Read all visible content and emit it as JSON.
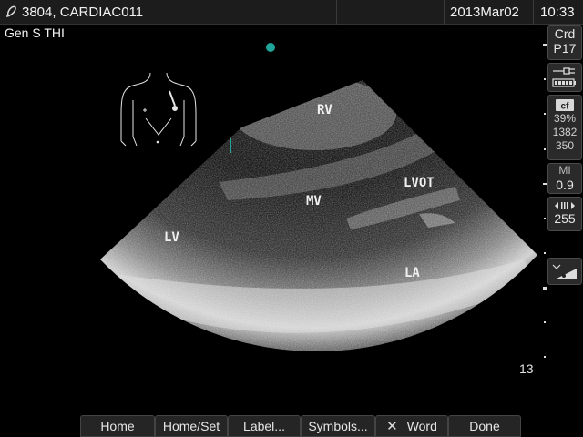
{
  "header": {
    "patient_id": "3804, CARDIAC011",
    "date": "2013Mar02",
    "time": "10:33",
    "logo_icon": "sonosite-logo-icon"
  },
  "imaging": {
    "preset": "Gen S THI",
    "labels": {
      "rv": "RV",
      "lvot": "LVOT",
      "mv": "MV",
      "lv": "LV",
      "la": "LA"
    },
    "depth": "13"
  },
  "right_panel": {
    "exam": "Crd",
    "transducer": "P17",
    "power_icon": "plug-icon",
    "battery_icon": "battery-icon",
    "cf_icon": "cf",
    "gain": "39%",
    "prf": "1382",
    "wall_filter": "350",
    "mi_label": "MI",
    "mi_value": "0.9",
    "dynamic_range_icon": "dynamic-range-icon",
    "dynamic_range": "255",
    "gain_curve_icon": "gain-curve-icon"
  },
  "softkeys": [
    {
      "label": "Home"
    },
    {
      "label": "Home/Set"
    },
    {
      "label": "Label..."
    },
    {
      "label": "Symbols..."
    },
    {
      "label": "Word"
    },
    {
      "label": "Done"
    }
  ],
  "colors": {
    "marker": "#1fa59a",
    "background": "#000000",
    "bar": "#1c1c1c"
  }
}
